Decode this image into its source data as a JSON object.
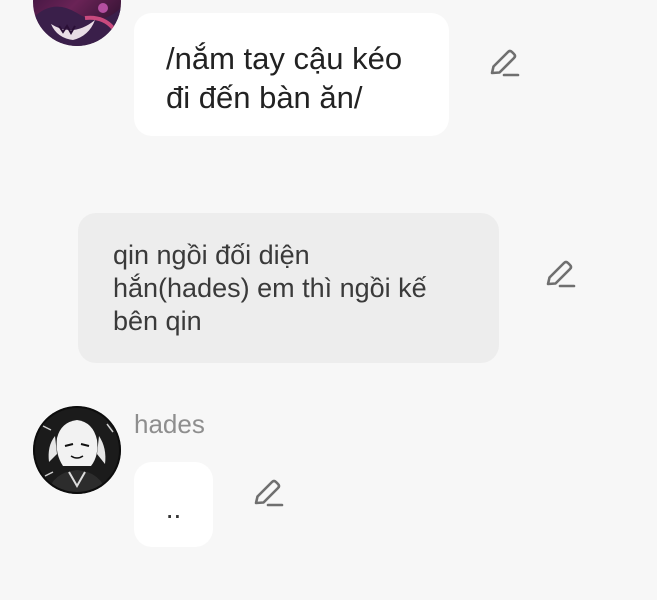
{
  "messages": [
    {
      "lines": [
        "/nắm tay cậu kéo",
        "đi đến bàn ăn/"
      ],
      "style": "user-bubble",
      "action_icon": "pencil-edit-icon"
    },
    {
      "lines": [
        "qin ngồi đối diện",
        "hắn(hades) em thì ngồi kế",
        "bên qin"
      ],
      "style": "narration-bubble",
      "action_icon": "pencil-edit-icon"
    },
    {
      "sender": "hades",
      "lines": [
        ".."
      ],
      "style": "character-bubble",
      "action_icon": "pencil-edit-icon"
    }
  ],
  "colors": {
    "background": "#f7f7f7",
    "user_bubble": "#ffffff",
    "narration_bubble": "#ededed",
    "sender_name": "#8e8e8e",
    "icon": "#6f6f6f"
  }
}
